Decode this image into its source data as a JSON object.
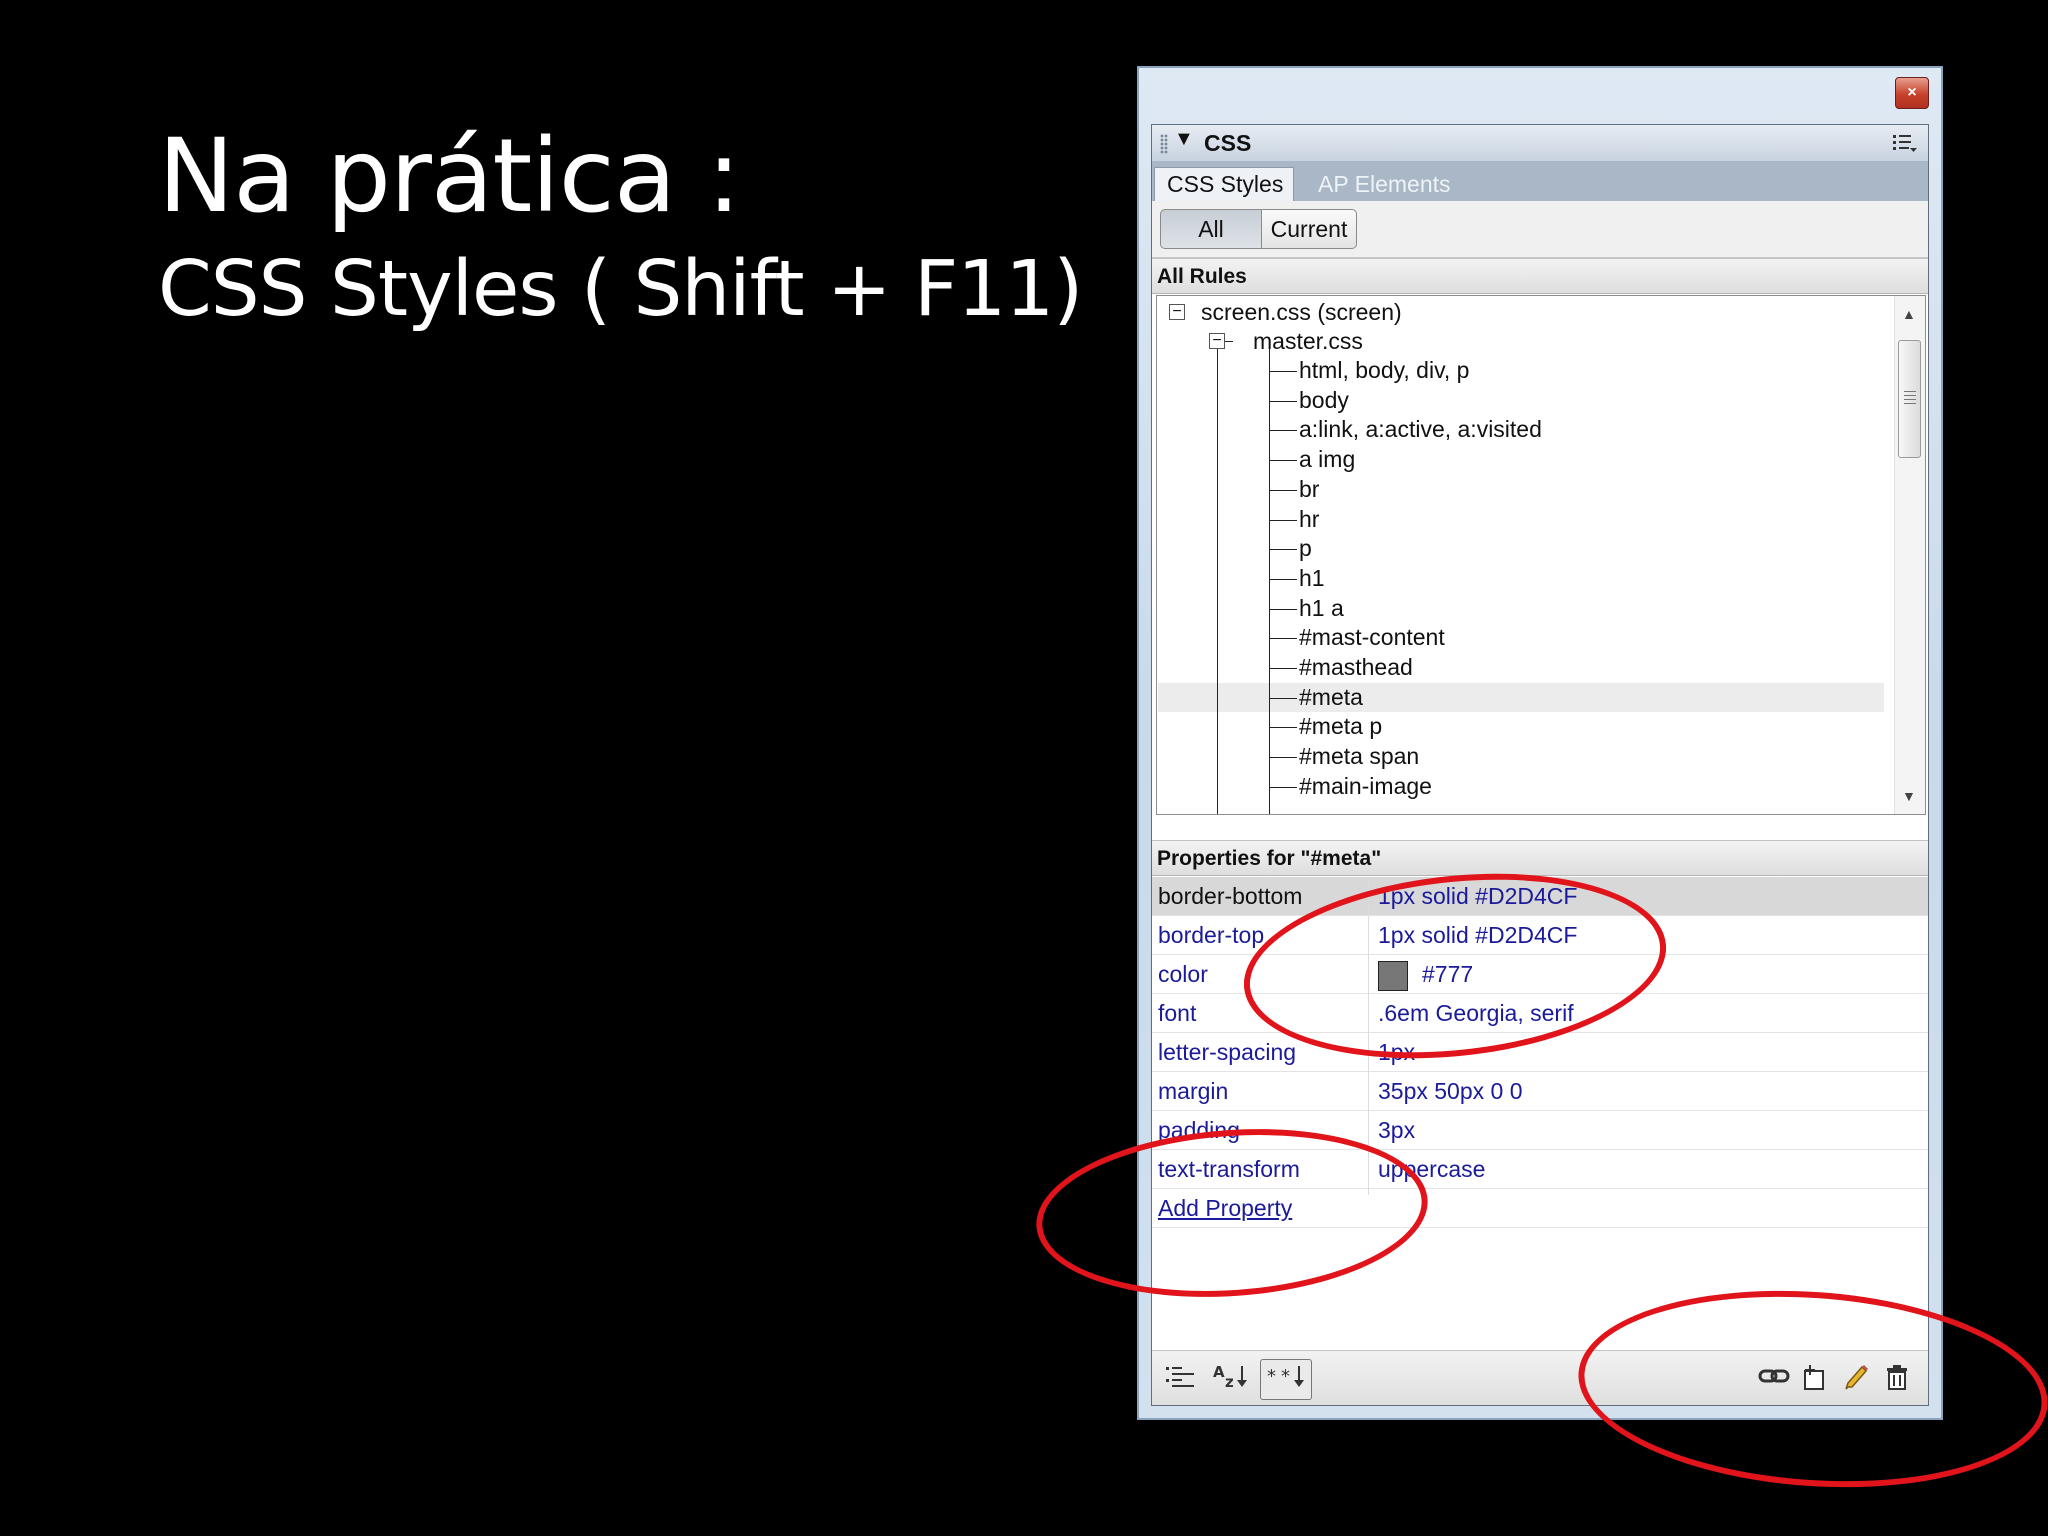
{
  "slide": {
    "title": "Na prática :",
    "subtitle": "CSS Styles ( Shift + F11)"
  },
  "window": {
    "close_icon": "×"
  },
  "panel": {
    "title": "CSS",
    "tabs": [
      {
        "label": "CSS Styles",
        "active": true
      },
      {
        "label": "AP Elements",
        "active": false
      }
    ],
    "modes": [
      {
        "label": "All",
        "selected": true
      },
      {
        "label": "Current",
        "selected": false
      }
    ],
    "rules_header": "All Rules",
    "tree": {
      "root": "screen.css (screen)",
      "child": "master.css",
      "rules": [
        "html, body, div, p",
        "body",
        "a:link, a:active, a:visited",
        "a img",
        "br",
        "hr",
        "p",
        "h1",
        "h1 a",
        "#mast-content",
        "#masthead",
        "#meta",
        "#meta p",
        "#meta span",
        "#main-image"
      ],
      "selected_rule": "#meta"
    },
    "properties_header": "Properties for \"#meta\"",
    "properties": [
      {
        "name": "border-bottom",
        "value": "1px solid #D2D4CF"
      },
      {
        "name": "border-top",
        "value": "1px solid #D2D4CF"
      },
      {
        "name": "color",
        "value": "#777",
        "swatch": "#777777"
      },
      {
        "name": "font",
        "value": ".6em Georgia, serif"
      },
      {
        "name": "letter-spacing",
        "value": "1px"
      },
      {
        "name": "margin",
        "value": "35px 50px 0 0"
      },
      {
        "name": "padding",
        "value": "3px"
      },
      {
        "name": "text-transform",
        "value": "uppercase"
      }
    ],
    "add_property_label": "Add Property",
    "toolbar_left": [
      "show-category-view-icon",
      "show-alphabetical-view-icon",
      "show-set-properties-icon"
    ],
    "toolbar_right": [
      "attach-style-sheet-icon",
      "new-css-rule-icon",
      "edit-style-icon",
      "delete-css-rule-icon"
    ]
  },
  "annotation_color": "#e0141a"
}
